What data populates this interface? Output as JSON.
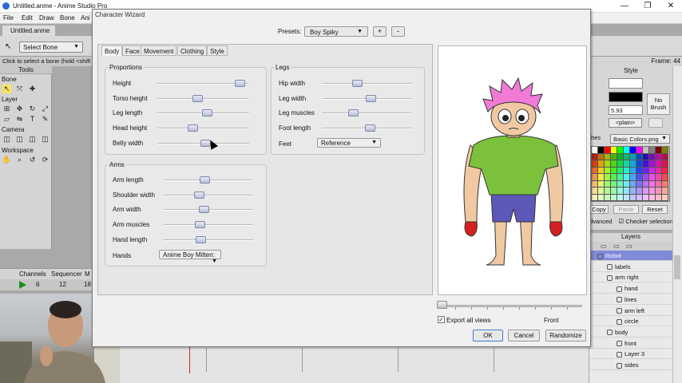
{
  "app": {
    "title": "Untitled.anme - Anime Studio Pro",
    "document_tab": "Untitled.anme",
    "menu": [
      "File",
      "Edit",
      "Draw",
      "Bone",
      "Ani"
    ],
    "toolbar": {
      "select_bone": "Select Bone"
    },
    "hint": "Click to select a bone (hold <shift"
  },
  "tools_panel": {
    "title": "Tools",
    "sections": [
      "Bone",
      "Layer",
      "Camera",
      "Workspace"
    ],
    "icons": {
      "bone": [
        "select-bone-icon",
        "translate-bone-icon",
        "add-bone-icon"
      ],
      "layer": [
        "transform-layer-icon",
        "move-layer-icon",
        "rotate-layer-icon",
        "scale-layer-icon",
        "shear-layer-icon",
        "flip-layer-icon",
        "text-tool-icon",
        "eyedropper-icon"
      ],
      "camera": [
        "camera-track-icon",
        "camera-zoom-icon",
        "camera-roll-icon",
        "camera-pan-icon"
      ],
      "workspace": [
        "hand-icon",
        "zoom-icon",
        "rotate-view-icon",
        "orbit-icon"
      ]
    }
  },
  "timeline": {
    "tabs": [
      "Channels",
      "Sequencer",
      "M"
    ],
    "frame_numbers": [
      "6",
      "12",
      "18"
    ]
  },
  "right_panel": {
    "frame_label": "Frame: 44",
    "style_title": "Style",
    "width_value": "5.93",
    "no_brush": "No Brush",
    "line_style": "<plain>",
    "palette_tab": "thes",
    "palette_name": "Basic Colors.png",
    "buttons": {
      "copy": "Copy",
      "paste": "Paste",
      "reset": "Reset"
    },
    "advanced_label": "dvanced",
    "checker_label": "Checker selection",
    "layers_title": "Layers",
    "layers": [
      {
        "name": "Robot",
        "indent": 0,
        "selected": true,
        "type": "bone"
      },
      {
        "name": "labels",
        "indent": 1,
        "selected": false,
        "type": "group"
      },
      {
        "name": "arm right",
        "indent": 1,
        "selected": false,
        "type": "group"
      },
      {
        "name": "hand",
        "indent": 2,
        "selected": false,
        "type": "vector"
      },
      {
        "name": "lines",
        "indent": 2,
        "selected": false,
        "type": "vector"
      },
      {
        "name": "arm left",
        "indent": 2,
        "selected": false,
        "type": "vector"
      },
      {
        "name": "circle",
        "indent": 2,
        "selected": false,
        "type": "vector"
      },
      {
        "name": "body",
        "indent": 1,
        "selected": false,
        "type": "group"
      },
      {
        "name": "front",
        "indent": 2,
        "selected": false,
        "type": "vector"
      },
      {
        "name": "Layer 3",
        "indent": 2,
        "selected": false,
        "type": "vector"
      },
      {
        "name": "sides",
        "indent": 2,
        "selected": false,
        "type": "vector"
      }
    ]
  },
  "dialog": {
    "title": "Character Wizard",
    "presets_label": "Presets:",
    "preset_value": "Boy Spiky",
    "add_label": "+",
    "remove_label": "-",
    "tabs": [
      "Body",
      "Face",
      "Movement",
      "Clothing",
      "Style"
    ],
    "active_tab": "Body",
    "proportions": {
      "title": "Proportions",
      "sliders": [
        {
          "label": "Height",
          "value": 0.95
        },
        {
          "label": "Torso height",
          "value": 0.43
        },
        {
          "label": "Leg length",
          "value": 0.55
        },
        {
          "label": "Head height",
          "value": 0.37
        },
        {
          "label": "Belly width",
          "value": 0.53
        }
      ]
    },
    "legs": {
      "title": "Legs",
      "sliders": [
        {
          "label": "Hip width",
          "value": 0.38
        },
        {
          "label": "Leg width",
          "value": 0.55
        },
        {
          "label": "Leg muscles",
          "value": 0.33
        },
        {
          "label": "Foot length",
          "value": 0.54
        }
      ],
      "feet_label": "Feet",
      "feet_value": "Reference"
    },
    "arms": {
      "title": "Arms",
      "sliders": [
        {
          "label": "Arm length",
          "value": 0.45
        },
        {
          "label": "Shoulder width",
          "value": 0.38
        },
        {
          "label": "Arm width",
          "value": 0.44
        },
        {
          "label": "Arm muscles",
          "value": 0.39
        },
        {
          "label": "Hand length",
          "value": 0.4
        }
      ],
      "hands_label": "Hands",
      "hands_value": "Anime Boy Mitten:"
    },
    "export_all_views": "Export all views",
    "view_label": "Front",
    "view_position": 0.0,
    "buttons": {
      "ok": "OK",
      "cancel": "Cancel",
      "randomize": "Randomize"
    }
  },
  "colors": {
    "hair": "#f07ad6",
    "shirt": "#7cc13b",
    "shorts": "#5c58b8",
    "skin": "#f0c9a3",
    "gloves": "#d42020",
    "layer_selected": "#7f8ad8"
  }
}
